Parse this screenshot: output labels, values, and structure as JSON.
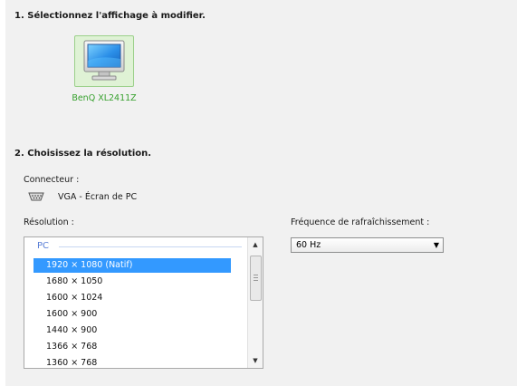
{
  "step1": {
    "heading": "1. Sélectionnez l'affichage à modifier."
  },
  "display": {
    "name": "BenQ XL2411Z",
    "icon": "monitor-icon",
    "tile_color": "#dff2d5",
    "label_color": "#37a12e"
  },
  "step2": {
    "heading": "2. Choisissez la résolution."
  },
  "connector": {
    "label": "Connecteur :",
    "icon": "vga-connector-icon",
    "value": "VGA - Écran de PC"
  },
  "resolution": {
    "label": "Résolution :",
    "group": "PC",
    "items": [
      {
        "label": "1920 × 1080 (Natif)",
        "selected": true
      },
      {
        "label": "1680 × 1050",
        "selected": false
      },
      {
        "label": "1600 × 1024",
        "selected": false
      },
      {
        "label": "1600 × 900",
        "selected": false
      },
      {
        "label": "1440 × 900",
        "selected": false
      },
      {
        "label": "1366 × 768",
        "selected": false
      },
      {
        "label": "1360 × 768",
        "selected": false
      }
    ],
    "selection_color": "#3399ff"
  },
  "refresh": {
    "label": "Fréquence de rafraîchissement :",
    "value": "60 Hz"
  },
  "icons": {
    "scroll_up": "▲",
    "scroll_down": "▼",
    "dropdown_arrow": "▼"
  }
}
